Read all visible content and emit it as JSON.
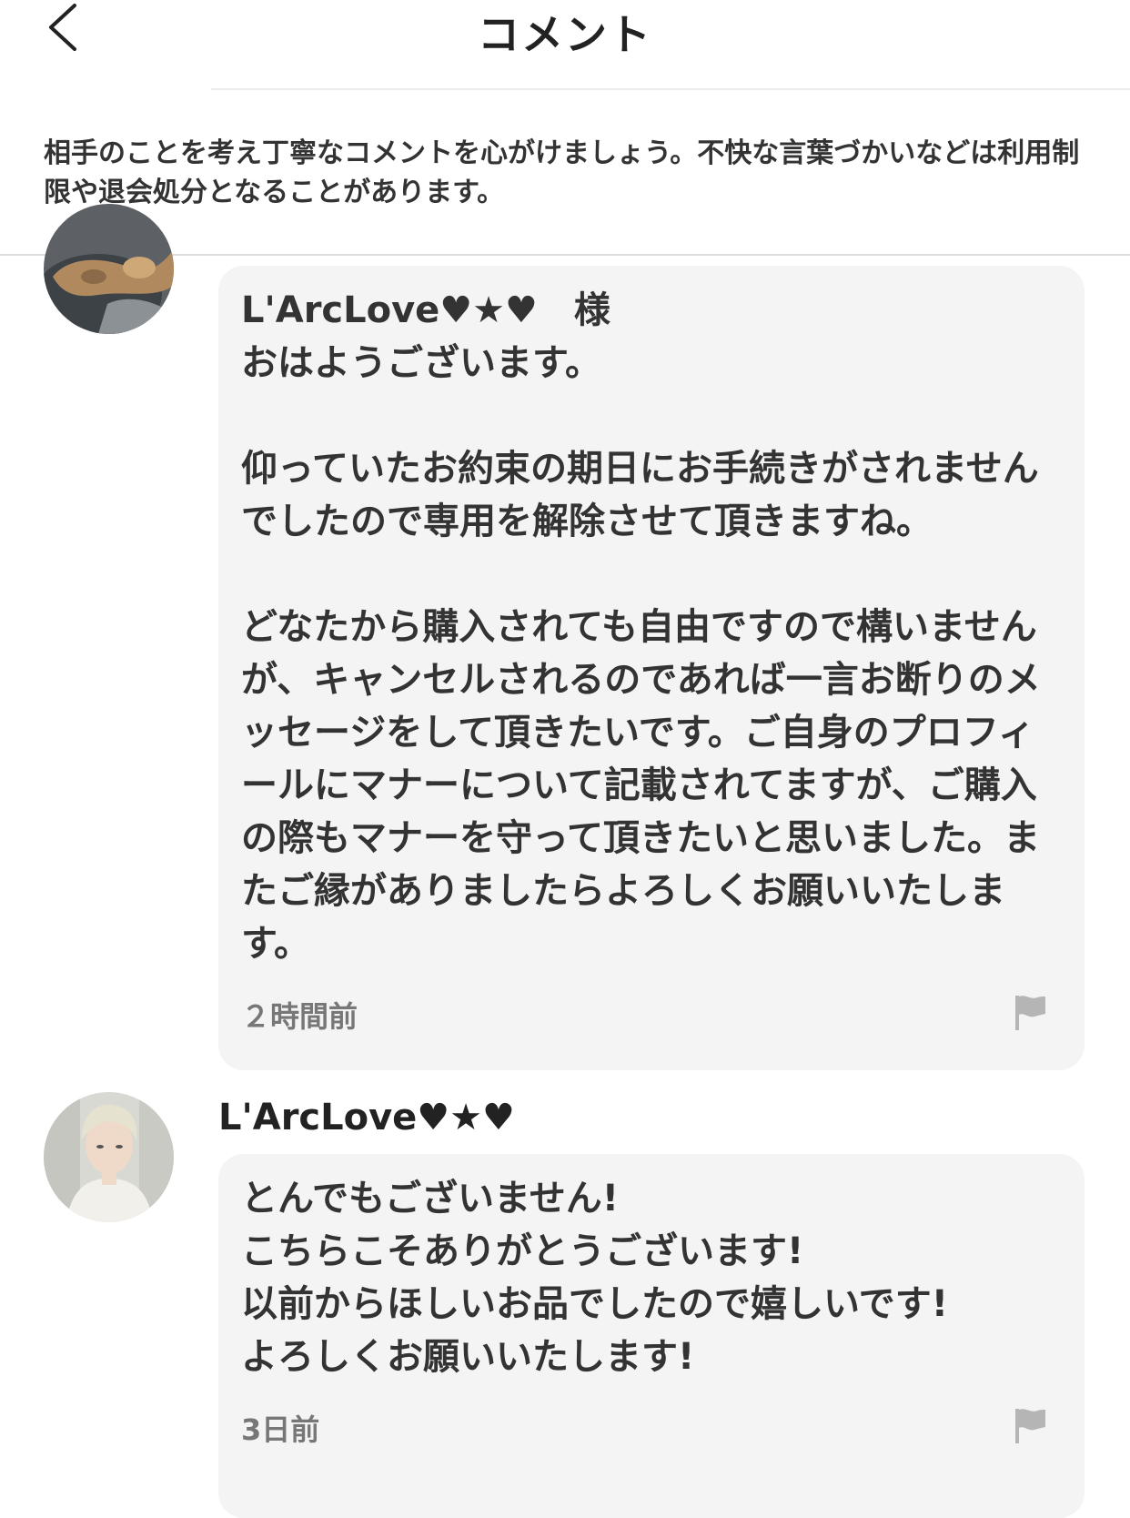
{
  "header": {
    "title": "コメント"
  },
  "notice": {
    "text": "相手のことを考え丁寧なコメントを心がけましょう。不快な言葉づかいなどは利用制限や退会処分となることがあります。"
  },
  "comments": [
    {
      "message": "L'ArcLove♥★♥　様\nおはようございます。\n\n仰っていたお約束の期日にお手続きがされませんでしたので専用を解除させて頂きますね。\n\nどなたから購入されても自由ですので構いませんが、キャンセルされるのであれば一言お断りのメッセージをして頂きたいです。ご自身のプロフィールにマナーについて記載されてますが、ご購入の際もマナーを守って頂きたいと思いました。またご縁がありましたらよろしくお願いいたします。",
      "time": "２時間前"
    },
    {
      "username": "L'ArcLove♥★♥",
      "message": "とんでもございません!\nこちらこそありがとうございます!\n以前からほしいお品でしたので嬉しいです!\nよろしくお願いいたします!",
      "time": "3日前"
    }
  ]
}
